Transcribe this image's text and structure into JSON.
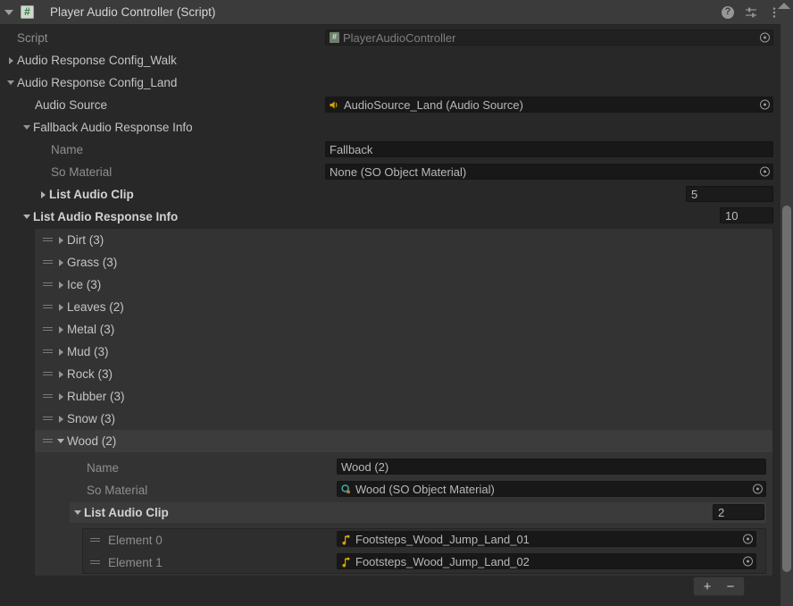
{
  "header": {
    "title": "Player Audio Controller (Script)",
    "foldout_icon": "triangle-down-icon",
    "script_icon": "csharp-script-icon",
    "icons": [
      {
        "name": "help-icon",
        "label": "?"
      },
      {
        "name": "preset-icon",
        "label": ""
      },
      {
        "name": "more-menu-icon",
        "label": ""
      }
    ]
  },
  "fields": {
    "script": {
      "label": "Script",
      "value": "PlayerAudioController",
      "icon": "csharp-script-icon",
      "picker": "object-picker-icon"
    },
    "config_walk": {
      "label": "Audio Response Config_Walk",
      "expanded": false,
      "icon": "triangle-right-icon"
    },
    "config_land": {
      "label": "Audio Response Config_Land",
      "expanded": true,
      "icon": "triangle-down-icon"
    },
    "audio_source": {
      "label": "Audio Source",
      "value": "AudioSource_Land (Audio Source)",
      "icon": "audio-source-icon",
      "picker": "object-picker-icon"
    },
    "fallback_info": {
      "label": "Fallback Audio Response Info",
      "expanded": true,
      "icon": "triangle-down-icon"
    },
    "fallback_name": {
      "label": "Name",
      "value": "Fallback"
    },
    "fallback_so_material": {
      "label": "So Material",
      "value": "None (SO Object Material)",
      "picker": "object-picker-icon"
    },
    "fallback_list_audio_clip": {
      "label": "List Audio Clip",
      "size": "5",
      "expanded": false,
      "icon": "triangle-right-icon"
    },
    "list_audio_response_info": {
      "label": "List Audio Response Info",
      "size": "10",
      "expanded": true,
      "icon": "triangle-down-icon"
    }
  },
  "response_list": {
    "items": [
      {
        "label": "Dirt (3)",
        "expanded": false,
        "selected": false
      },
      {
        "label": "Grass (3)",
        "expanded": false,
        "selected": false
      },
      {
        "label": "Ice (3)",
        "expanded": false,
        "selected": false
      },
      {
        "label": "Leaves (2)",
        "expanded": false,
        "selected": false
      },
      {
        "label": "Metal (3)",
        "expanded": false,
        "selected": false
      },
      {
        "label": "Mud (3)",
        "expanded": false,
        "selected": false
      },
      {
        "label": "Rock (3)",
        "expanded": false,
        "selected": false
      },
      {
        "label": "Rubber (3)",
        "expanded": false,
        "selected": false
      },
      {
        "label": "Snow (3)",
        "expanded": false,
        "selected": false
      },
      {
        "label": "Wood (2)",
        "expanded": true,
        "selected": true
      }
    ]
  },
  "wood_detail": {
    "name": {
      "label": "Name",
      "value": "Wood (2)"
    },
    "so_material": {
      "label": "So Material",
      "value": "Wood (SO Object Material)",
      "icon": "scriptable-object-icon",
      "picker": "object-picker-icon"
    },
    "list_audio_clip": {
      "label": "List Audio Clip",
      "size": "2",
      "expanded": true,
      "icon": "triangle-down-icon"
    },
    "elements": [
      {
        "label": "Element 0",
        "value": "Footsteps_Wood_Jump_Land_01",
        "icon": "audio-clip-icon",
        "picker": "object-picker-icon"
      },
      {
        "label": "Element 1",
        "value": "Footsteps_Wood_Jump_Land_02",
        "icon": "audio-clip-icon",
        "picker": "object-picker-icon"
      }
    ],
    "add_button": "+",
    "remove_button": "−"
  },
  "colors": {
    "background": "#282828",
    "header_bg": "#3b3b3b",
    "list_bg": "#333333",
    "field_bg": "#181818",
    "accent_audio": "#d8a200",
    "accent_script": "#5f9e5f"
  }
}
